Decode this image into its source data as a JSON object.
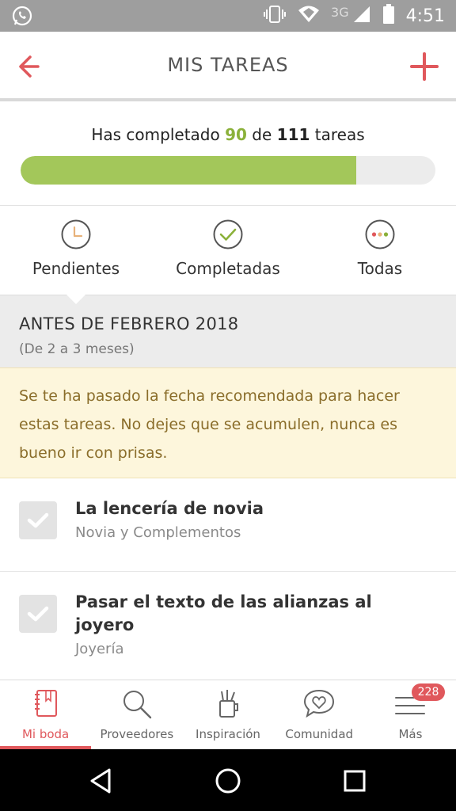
{
  "status_bar": {
    "time": "4:51",
    "network": "3G",
    "icons": [
      "whatsapp-icon",
      "vibrate-icon",
      "wifi-icon",
      "signal-icon",
      "battery-icon"
    ]
  },
  "header": {
    "title": "MIS TAREAS",
    "back_icon": "arrow-left-icon",
    "add_icon": "plus-icon"
  },
  "progress": {
    "prefix": "Has completado ",
    "completed": "90",
    "middle": " de ",
    "total": "111",
    "suffix": " tareas",
    "fraction": 0.81
  },
  "filters": [
    {
      "label": "Pendientes",
      "icon": "clock-icon"
    },
    {
      "label": "Completadas",
      "icon": "check-circle-icon"
    },
    {
      "label": "Todas",
      "icon": "dots-circle-icon"
    }
  ],
  "section": {
    "title": "ANTES DE FEBRERO 2018",
    "subtitle": "(De 2 a 3 meses)"
  },
  "warning": {
    "text": "Se te ha pasado la fecha recomendada para hacer estas tareas. No dejes que se acumulen, nunca es bueno ir con prisas."
  },
  "tasks": [
    {
      "title": "La lencería de novia",
      "category": "Novia y Complementos"
    },
    {
      "title": "Pasar el texto de las alianzas al joyero",
      "category": "Joyería"
    }
  ],
  "bottom_nav": [
    {
      "label": "Mi boda",
      "icon": "notebook-icon",
      "active": true
    },
    {
      "label": "Proveedores",
      "icon": "search-icon"
    },
    {
      "label": "Inspiración",
      "icon": "inspiration-icon"
    },
    {
      "label": "Comunidad",
      "icon": "chat-heart-icon"
    },
    {
      "label": "Más",
      "icon": "menu-icon",
      "badge": "228"
    }
  ],
  "colors": {
    "accent": "#e0585c",
    "progress": "#a3c75a",
    "progress_text": "#8bb13a",
    "warning_bg": "#fdf6dc",
    "warning_text": "#8a6d2a"
  }
}
